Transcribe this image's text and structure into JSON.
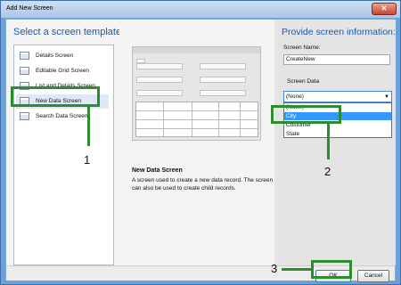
{
  "window": {
    "title": "Add New Screen",
    "close_glyph": "✕"
  },
  "left": {
    "heading": "Select a screen template:",
    "templates": [
      {
        "label": "Details Screen",
        "icon": "details-screen-icon"
      },
      {
        "label": "Editable Grid Screen",
        "icon": "grid-screen-icon"
      },
      {
        "label": "List and Details Screen",
        "icon": "list-details-icon"
      },
      {
        "label": "New Data Screen",
        "icon": "new-data-screen-icon",
        "selected": true
      },
      {
        "label": "Search Data Screen",
        "icon": "search-screen-icon"
      }
    ]
  },
  "preview": {
    "title": "New Data Screen",
    "description": "A screen used to create a new data record.  The screen can also be used to create child records."
  },
  "right": {
    "heading": "Provide screen information:",
    "screen_name_label": "Screen Name:",
    "screen_name_value": "CreateNew",
    "screen_data_label": "Screen Data",
    "screen_data_selected": "(None)",
    "options": [
      "(None)",
      "City",
      "Customer",
      "State"
    ],
    "highlighted_option": "City"
  },
  "footer": {
    "ok_label": "OK",
    "cancel_label": "Cancel"
  },
  "annotations": {
    "one": "1",
    "two": "2",
    "three": "3",
    "color": "#2e8b2e"
  }
}
